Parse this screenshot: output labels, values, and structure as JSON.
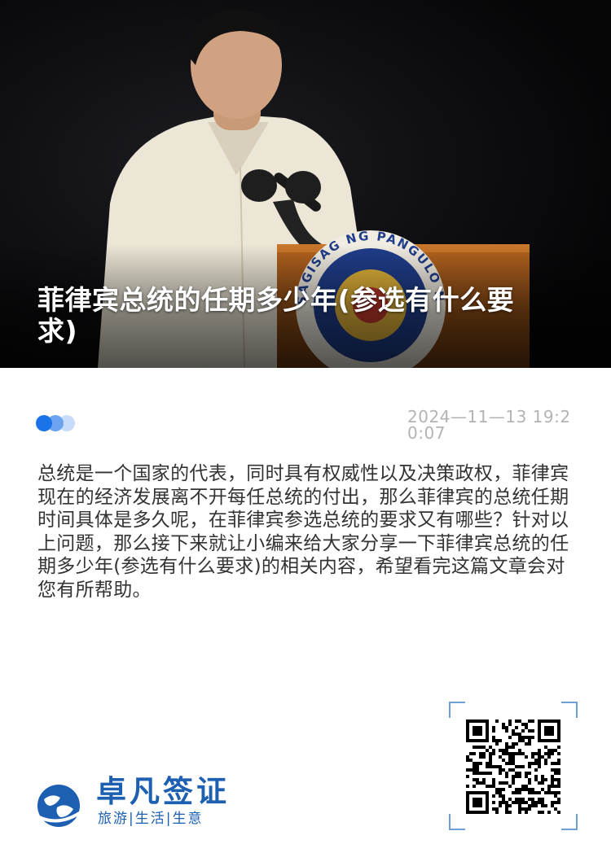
{
  "hero": {
    "title": "菲律宾总统的任期多少年(参选有什么要求)",
    "seal_text": "SAGISAG NG PANGULO NG PILIPINAS"
  },
  "meta": {
    "date": "2024—11—13 19:20:07"
  },
  "article": {
    "intro": "总统是一个国家的代表，同时具有权威性以及决策政权，菲律宾现在的经济发展离不开每任总统的付出，那么菲律宾的总统任期时间具体是多久呢，在菲律宾参选总统的要求又有哪些？针对以上问题，那么接下来就让小编来给大家分享一下菲律宾总统的任期多少年(参选有什么要求)的相关内容，希望看完这篇文章会对您有所帮助。"
  },
  "brand": {
    "name": "卓凡签证",
    "tagline": "旅游|生活|生意",
    "color": "#1d5fb0"
  },
  "qr": {
    "icon": "qr-code-icon"
  },
  "colors": {
    "accent": "#1a73e8",
    "text": "#333333",
    "muted": "#b3b3b3"
  }
}
